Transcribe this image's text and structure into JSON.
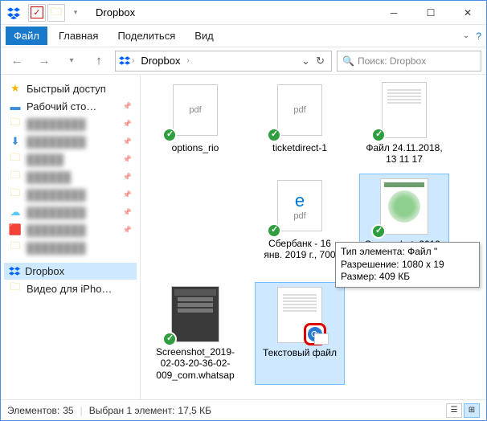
{
  "window": {
    "title": "Dropbox"
  },
  "menu": {
    "file": "Файл",
    "home": "Главная",
    "share": "Поделиться",
    "view": "Вид"
  },
  "breadcrumb": {
    "root": "Dropbox"
  },
  "search": {
    "placeholder": "Поиск: Dropbox"
  },
  "sidebar": {
    "quick": "Быстрый доступ",
    "desktop": "Рабочий сто…",
    "dropbox": "Dropbox",
    "video": "Видео для iPho…"
  },
  "files": {
    "options": "options_rio",
    "ticket": "ticketdirect-1",
    "file1": "Файл 24.11.2018, 13 11 17",
    "sber": "Сбербанк - 16 янв. 2019 г., 700",
    "shot1": "Screenshot_2019-01-30-20-32-47-404",
    "shot2": "Screenshot_2019-02-03-20-36-02-009_com.whatsapp",
    "txt": "Текстовый файл"
  },
  "pdf_label": "pdf",
  "tooltip": {
    "line1": "Тип элемента: Файл \"",
    "line2": "Разрешение: 1080 x 19",
    "line3": "Размер: 409 КБ"
  },
  "status": {
    "count_label": "Элементов:",
    "count": "35",
    "sel_label": "Выбран 1 элемент:",
    "sel_size": "17,5 КБ"
  }
}
